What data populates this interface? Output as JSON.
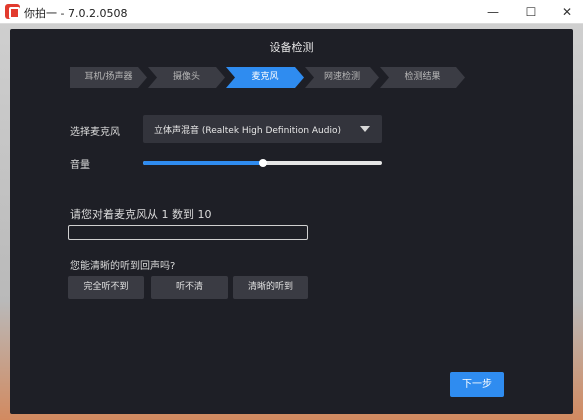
{
  "window": {
    "title": "你拍一 - 7.0.2.0508",
    "minimize_glyph": "—",
    "maximize_glyph": "☐",
    "close_glyph": "✕"
  },
  "dialog": {
    "title": "设备检测",
    "steps": [
      {
        "label": "耳机/扬声器",
        "active": false
      },
      {
        "label": "摄像头",
        "active": false
      },
      {
        "label": "麦克风",
        "active": true
      },
      {
        "label": "网速检测",
        "active": false
      },
      {
        "label": "检测结果",
        "active": false
      }
    ],
    "microphone": {
      "label": "选择麦克风",
      "selected": "立体声混音 (Realtek High Definition Audio)"
    },
    "volume": {
      "label": "音量",
      "level_percent": 50
    },
    "count_prompt": "请您对着麦克风从 1 数到 10",
    "mic_input_level_percent": 0,
    "echo_question": "您能清晰的听到回声吗?",
    "answers": [
      "完全听不到",
      "听不清",
      "清晰的听到"
    ],
    "next_label": "下一步"
  },
  "colors": {
    "accent": "#2f8cf0",
    "dialog_bg": "#1e1f26",
    "step_inactive": "#3b3c44"
  }
}
